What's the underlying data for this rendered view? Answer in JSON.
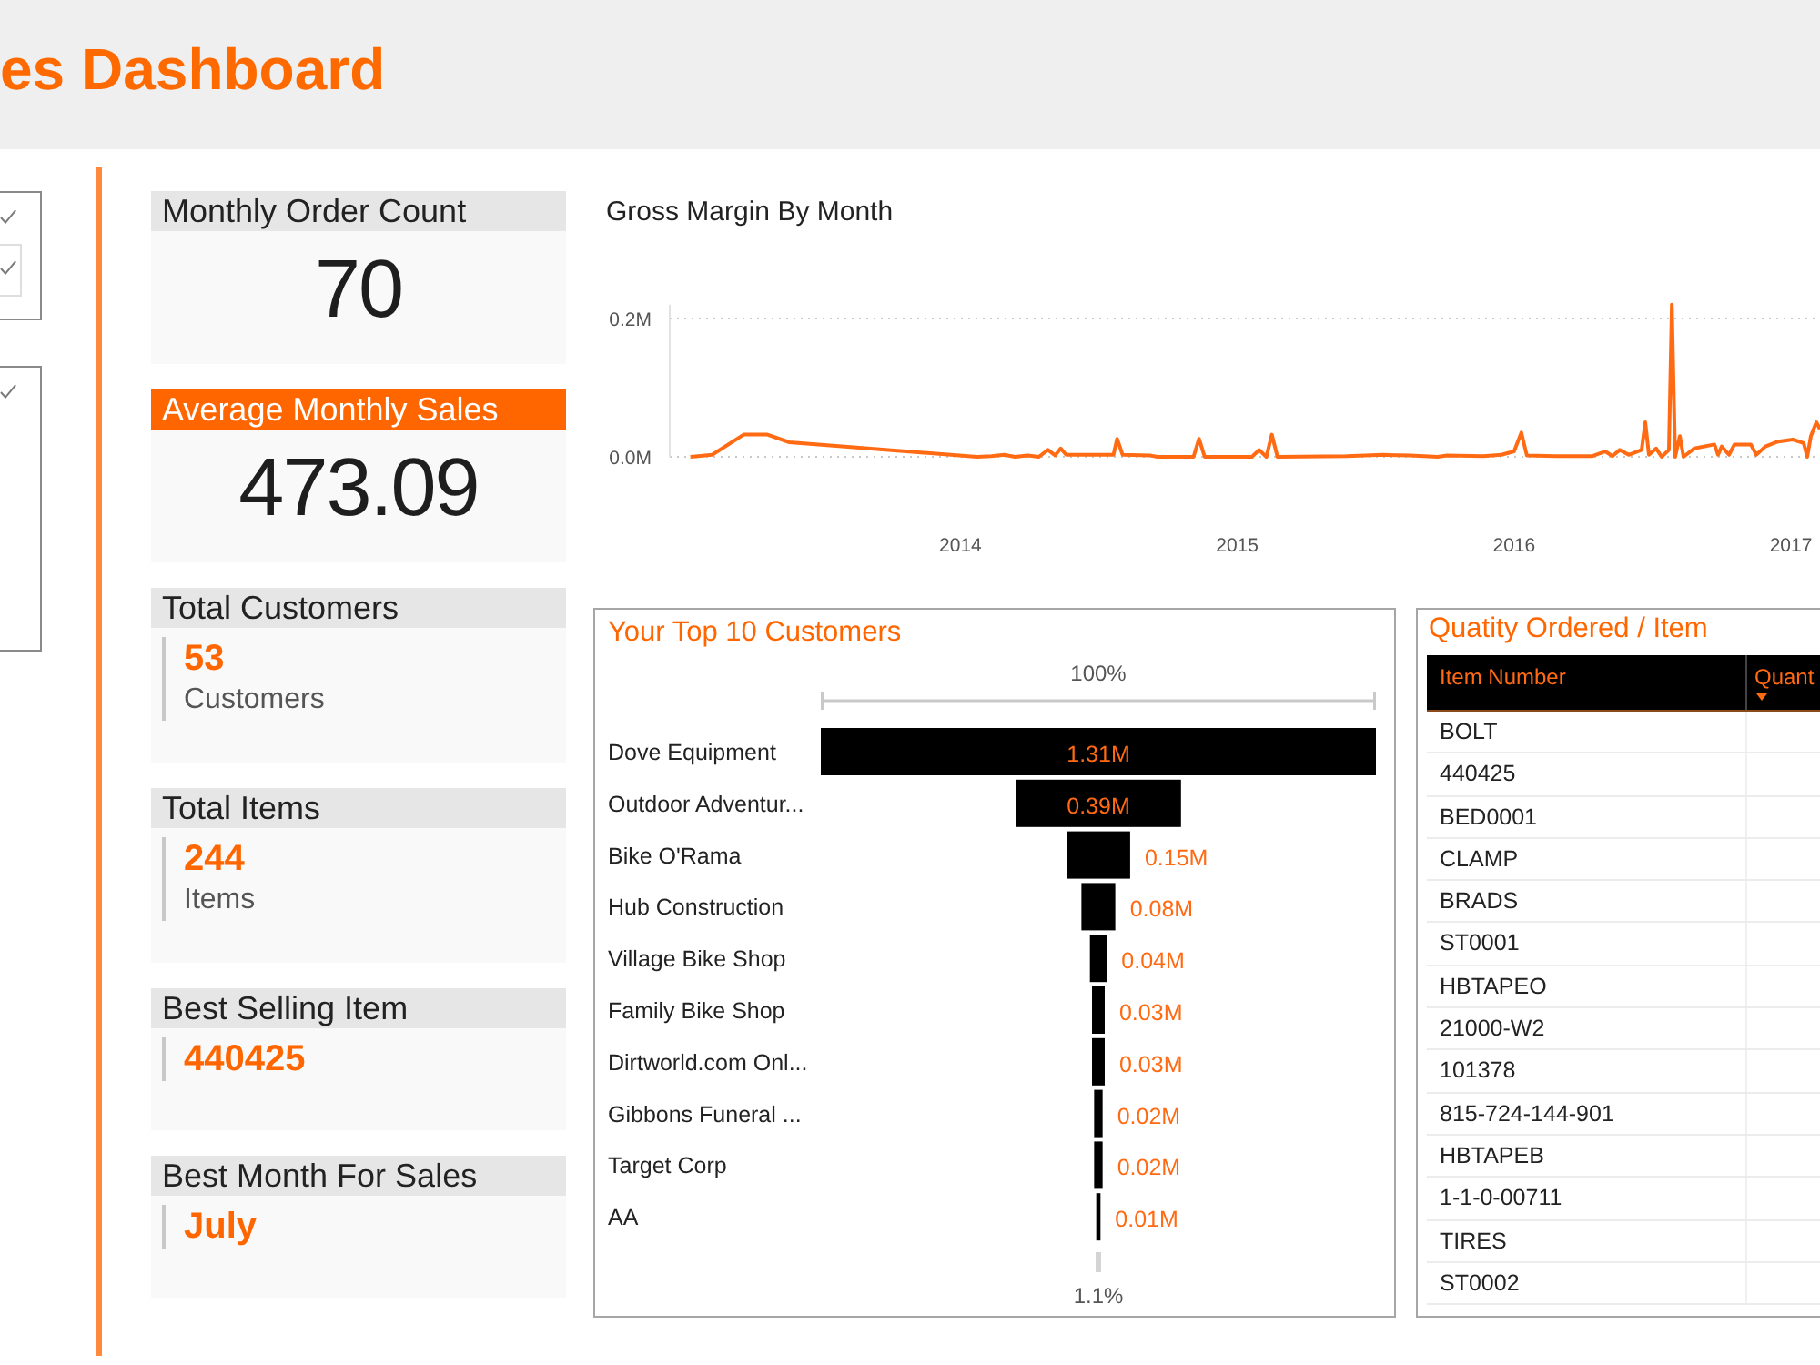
{
  "header": {
    "title": "es Dashboard"
  },
  "cards": [
    {
      "title": "Monthly Order Count",
      "highlighted": false,
      "kind": "number",
      "value": "70"
    },
    {
      "title": "Average Monthly Sales",
      "highlighted": true,
      "kind": "number",
      "value": "473.09"
    },
    {
      "title": "Total Customers",
      "highlighted": false,
      "kind": "kpi",
      "value": "53",
      "caption": "Customers"
    },
    {
      "title": "Total Items",
      "highlighted": false,
      "kind": "kpi",
      "value": "244",
      "caption": "Items"
    },
    {
      "title": "Best Selling Item",
      "highlighted": false,
      "kind": "kpi",
      "value": "440425"
    },
    {
      "title": "Best Month For Sales",
      "highlighted": false,
      "kind": "kpi",
      "value": "July"
    }
  ],
  "gross_margin": {
    "chart_data": {
      "type": "line",
      "title": "Gross Margin By Month",
      "x": [
        2013.024,
        2013.103,
        2013.217,
        2013.303,
        2013.382,
        2014.059,
        2014.112,
        2014.158,
        2014.197,
        2014.243,
        2014.283,
        2014.316,
        2014.342,
        2014.362,
        2014.382,
        2014.553,
        2014.566,
        2014.586,
        2014.684,
        2014.711,
        2014.842,
        2014.862,
        2014.882,
        2015.053,
        2015.079,
        2015.105,
        2015.125,
        2015.145,
        2015.395,
        2015.526,
        2015.625,
        2015.724,
        2015.757,
        2015.888,
        2015.954,
        2016.0,
        2016.026,
        2016.046,
        2016.151,
        2016.283,
        2016.329,
        2016.355,
        2016.382,
        2016.414,
        2016.461,
        2016.474,
        2016.487,
        2016.513,
        2016.533,
        2016.559,
        2016.57,
        2016.582,
        2016.599,
        2016.612,
        2016.651,
        2016.724,
        2016.737,
        2016.75,
        2016.776,
        2016.796,
        2016.855,
        2016.875,
        2016.908,
        2016.954,
        2017.007,
        2017.046,
        2017.059,
        2017.072,
        2017.092,
        2017.105
      ],
      "values": [
        0,
        0.003,
        0.032,
        0.032,
        0.021,
        0,
        0.001,
        0.003,
        0,
        0.002,
        0,
        0.01,
        0.002,
        0.012,
        0.003,
        0.003,
        0.026,
        0.003,
        0.002,
        0,
        0,
        0.026,
        0,
        0,
        0.01,
        0,
        0.032,
        0,
        0.001,
        0.003,
        0.002,
        0,
        0.002,
        0.001,
        0.003,
        0.008,
        0.035,
        0.002,
        0.001,
        0.001,
        0.008,
        0.001,
        0.01,
        0.003,
        0.01,
        0.05,
        0.003,
        0.012,
        0,
        0.01,
        0.22,
        0,
        0.03,
        0,
        0.012,
        0.018,
        0.003,
        0.015,
        0.003,
        0.018,
        0.018,
        0.003,
        0.015,
        0.022,
        0.025,
        0.02,
        0,
        0.03,
        0.05,
        0.04
      ],
      "xlim": [
        2012.95,
        2017.105
      ],
      "ylim": [
        0,
        0.22
      ],
      "xticks": [
        2014,
        2015,
        2016,
        2017
      ],
      "yticks": [
        {
          "value": 0,
          "label": "0.0M"
        },
        {
          "value": 0.2,
          "label": "0.2M"
        }
      ]
    }
  },
  "top_customers": {
    "chart_data": {
      "type": "other",
      "title": "Your Top 10 Customers",
      "categories": [
        "Dove Equipment",
        "Outdoor Adventur...",
        "Bike O'Rama",
        "Hub Construction",
        "Village Bike Shop",
        "Family Bike Shop",
        "Dirtworld.com Onl...",
        "Gibbons Funeral ...",
        "Target Corp",
        "AA"
      ],
      "values": [
        1.31,
        0.39,
        0.15,
        0.08,
        0.04,
        0.03,
        0.03,
        0.02,
        0.02,
        0.01
      ],
      "value_labels": [
        "1.31M",
        "0.39M",
        "0.15M",
        "0.08M",
        "0.04M",
        "0.03M",
        "0.03M",
        "0.02M",
        "0.02M",
        "0.01M"
      ]
    },
    "top_percent": "100%",
    "bottom_percent": "1.1%"
  },
  "quantity_table": {
    "title": "Quatity Ordered / Item",
    "columns": [
      {
        "label": "Item Number",
        "sorted": false
      },
      {
        "label": "Quant",
        "sorted": true
      }
    ],
    "rows": [
      [
        "BOLT"
      ],
      [
        "440425"
      ],
      [
        "BED0001"
      ],
      [
        "CLAMP"
      ],
      [
        "BRADS"
      ],
      [
        "ST0001"
      ],
      [
        "HBTAPEO"
      ],
      [
        "21000-W2"
      ],
      [
        "101378"
      ],
      [
        "815-724-144-901"
      ],
      [
        "HBTAPEB"
      ],
      [
        "1-1-0-00711"
      ],
      [
        "TIRES"
      ],
      [
        "ST0002"
      ]
    ]
  }
}
